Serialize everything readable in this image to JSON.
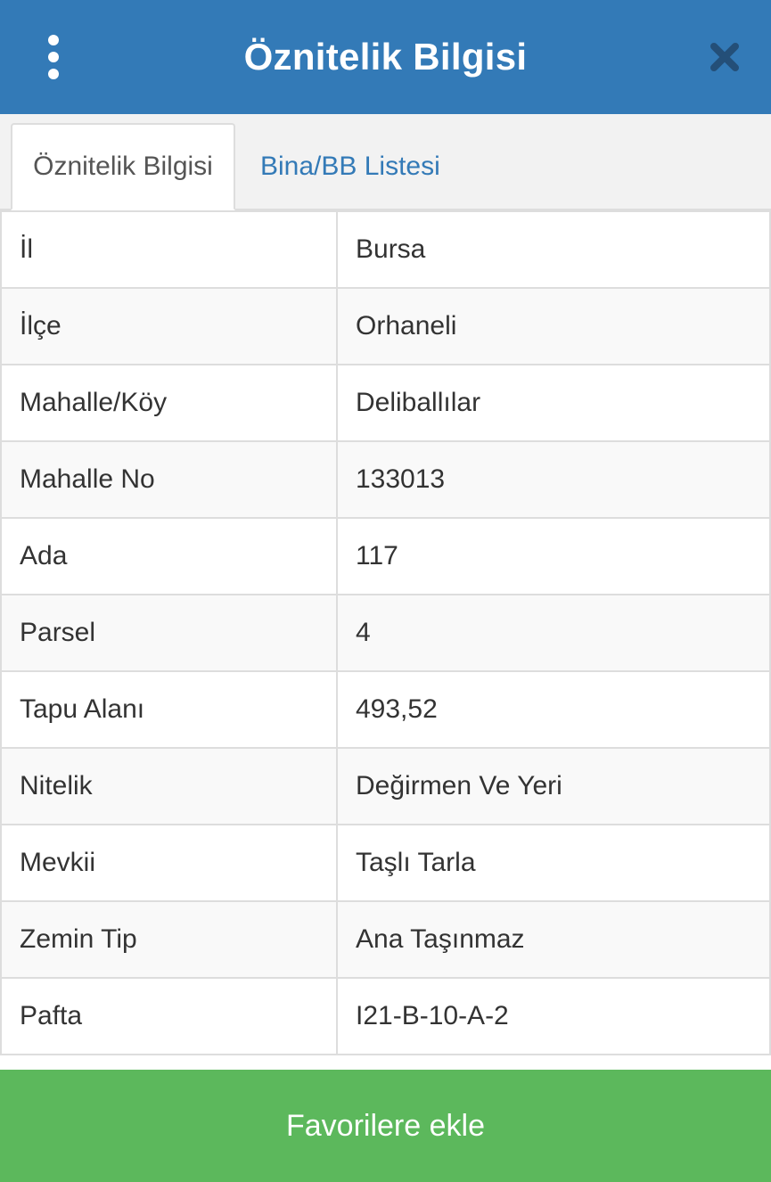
{
  "header": {
    "title": "Öznitelik Bilgisi",
    "menu_icon": "vertical-dots-icon",
    "close_icon": "close-icon",
    "bg_color": "#337ab7"
  },
  "tabs": [
    {
      "label": "Öznitelik Bilgisi",
      "active": true
    },
    {
      "label": "Bina/BB Listesi",
      "active": false
    }
  ],
  "rows": [
    {
      "key": "İl",
      "value": "Bursa"
    },
    {
      "key": "İlçe",
      "value": "Orhaneli"
    },
    {
      "key": "Mahalle/Köy",
      "value": "Deliballılar"
    },
    {
      "key": "Mahalle No",
      "value": "133013"
    },
    {
      "key": "Ada",
      "value": "117"
    },
    {
      "key": "Parsel",
      "value": "4"
    },
    {
      "key": "Tapu Alanı",
      "value": "493,52"
    },
    {
      "key": "Nitelik",
      "value": "Değirmen Ve Yeri"
    },
    {
      "key": "Mevkii",
      "value": "Taşlı Tarla"
    },
    {
      "key": "Zemin Tip",
      "value": "Ana Taşınmaz"
    },
    {
      "key": "Pafta",
      "value": "I21-B-10-A-2"
    }
  ],
  "footer": {
    "favorite_label": "Favorilere ekle",
    "bg_color": "#5cb85c"
  }
}
